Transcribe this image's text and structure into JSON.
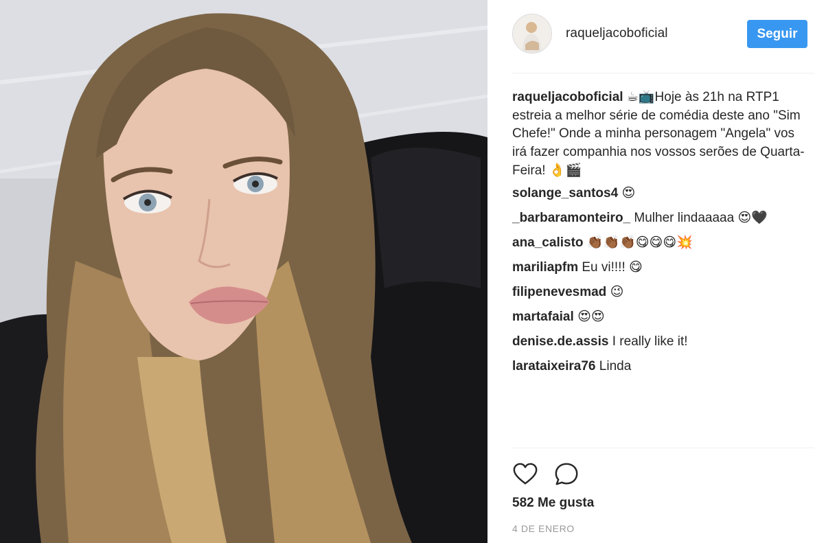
{
  "post": {
    "photo_icon": "selfie-photo",
    "author": "raqueljacoboficial",
    "follow_label": "Seguir",
    "accent_color": "#3897f0",
    "caption": {
      "username": "raqueljacoboficial",
      "text_pre": "☕📺",
      "text": "Hoje às 21h na RTP1 estreia a melhor série de comédia deste ano \"Sim Chefe!\" Onde a minha personagem \"Angela\" vos irá fazer companhia nos vossos serões de Quarta-Feira!",
      "text_post": "👌🎬"
    },
    "comments": [
      {
        "username": "solange_santos4",
        "text": "😍"
      },
      {
        "username": "_barbaramonteiro_",
        "text": "Mulher lindaaaaa 😍🖤"
      },
      {
        "username": "ana_calisto",
        "text": "👏🏾👏🏾👏🏾😋😋😋💥"
      },
      {
        "username": "mariliapfm",
        "text": "Eu vi!!!! 😋"
      },
      {
        "username": "filipenevesmad",
        "text": "😉"
      },
      {
        "username": "martafaial",
        "text": "😍😍"
      },
      {
        "username": "denise.de.assis",
        "text": "I really like it!"
      },
      {
        "username": "larataixeira76",
        "text": "Linda"
      }
    ],
    "likes": "582 Me gusta",
    "date": "4 DE ENERO",
    "icons": {
      "like": "heart-icon",
      "comment": "speech-bubble-icon"
    }
  }
}
